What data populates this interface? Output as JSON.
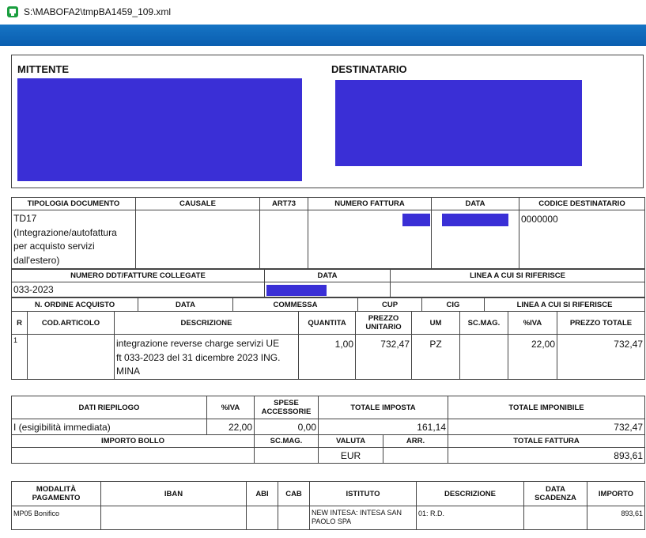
{
  "window": {
    "title": "S:\\MABOFA2\\tmpBA1459_109.xml",
    "icon": "xml-viewer-icon"
  },
  "parties": {
    "sender_label": "MITTENTE",
    "recipient_label": "DESTINATARIO"
  },
  "header_table": {
    "columns": [
      "TIPOLOGIA DOCUMENTO",
      "CAUSALE",
      "ART73",
      "NUMERO FATTURA",
      "DATA",
      "CODICE DESTINATARIO"
    ],
    "tipologia_line1": "TD17",
    "tipologia_line2": "(Integrazione/autofattura",
    "tipologia_line3": "per acquisto servizi",
    "tipologia_line4": "dall'estero)",
    "codice_destinatario": "0000000"
  },
  "ddt_table": {
    "columns": [
      "NUMERO DDT/FATTURE COLLEGATE",
      "DATA",
      "LINEA A CUI SI RIFERISCE"
    ],
    "numero": "033-2023"
  },
  "order_table": {
    "columns": [
      "N. ORDINE ACQUISTO",
      "DATA",
      "COMMESSA",
      "CUP",
      "CIG",
      "LINEA A CUI SI RIFERISCE"
    ]
  },
  "lines_table": {
    "columns": [
      "R",
      "COD.ARTICOLO",
      "DESCRIZIONE",
      "QUANTITA",
      "PREZZO UNITARIO",
      "UM",
      "SC.MAG.",
      "%IVA",
      "PREZZO TOTALE"
    ],
    "rows": [
      {
        "r": "1",
        "cod": "",
        "desc_line1": "integrazione reverse charge servizi UE",
        "desc_line2": "ft 033-2023 del 31 dicembre 2023 ING.",
        "desc_line3": "MINA",
        "quantita": "1,00",
        "prezzo_unitario": "732,47",
        "um": "PZ",
        "sc_mag": "",
        "iva": "22,00",
        "prezzo_totale": "732,47"
      }
    ]
  },
  "summary_table": {
    "columns": [
      "DATI RIEPILOGO",
      "%IVA",
      "SPESE ACCESSORIE",
      "TOTALE IMPOSTA",
      "TOTALE IMPONIBILE"
    ],
    "row": {
      "dati": "I (esigibilità immediata)",
      "iva": "22,00",
      "spese": "0,00",
      "imposta": "161,14",
      "imponibile": "732,47"
    },
    "columns2": [
      "IMPORTO BOLLO",
      "SC.MAG.",
      "VALUTA",
      "ARR.",
      "TOTALE FATTURA"
    ],
    "row2": {
      "bollo": "",
      "sc_mag": "",
      "valuta": "EUR",
      "arr": "",
      "totale": "893,61"
    }
  },
  "payment_table": {
    "columns": [
      "MODALITÀ PAGAMENTO",
      "IBAN",
      "ABI",
      "CAB",
      "ISTITUTO",
      "DESCRIZIONE",
      "DATA SCADENZA",
      "IMPORTO"
    ],
    "row": {
      "modalita": "MP05 Bonifico",
      "iban": "",
      "abi": "",
      "cab": "",
      "istituto_line1": "NEW INTESA: INTESA SAN",
      "istituto_line2": "PAOLO SPA",
      "descrizione": "01: R.D.",
      "scadenza": "",
      "importo": "893,61"
    }
  },
  "colors": {
    "redaction": "#3a2fd6",
    "titlebar_accent": "#0a5eb0",
    "app_icon": "#1a9e3f"
  }
}
